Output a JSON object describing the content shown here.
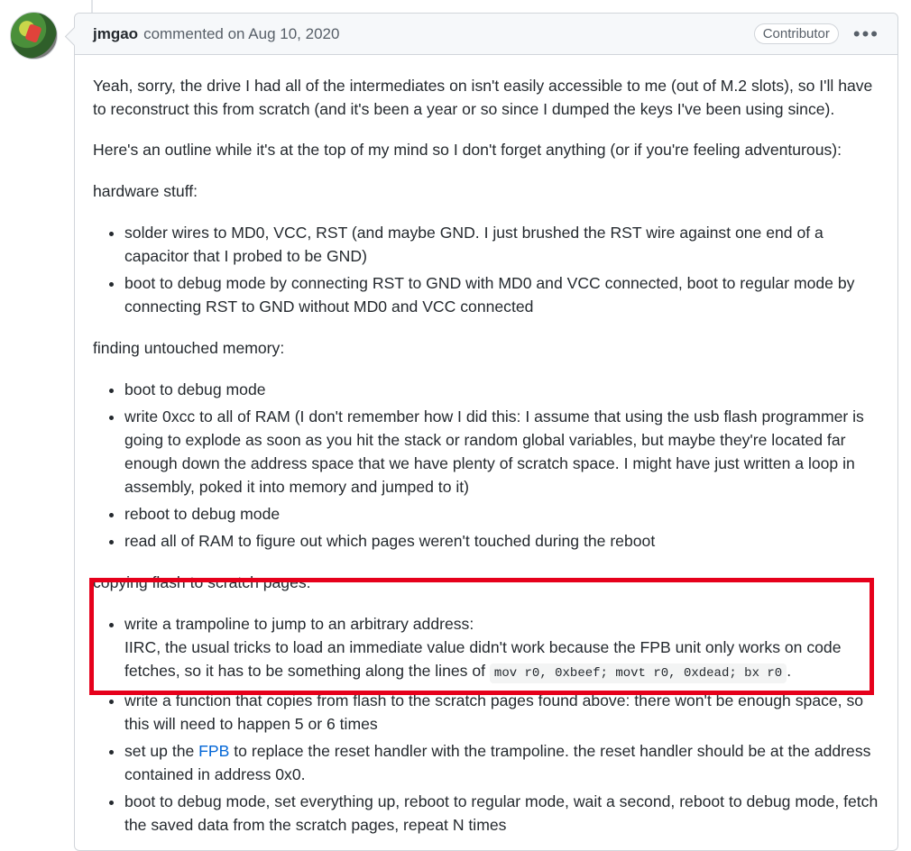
{
  "comment": {
    "author": "jmgao",
    "action": "commented on Aug 10, 2020",
    "badge": "Contributor",
    "menu_icon": "kebab-horizontal-icon",
    "avatar_icon": "user-avatar"
  },
  "body": {
    "p1": "Yeah, sorry, the drive I had all of the intermediates on isn't easily accessible to me (out of M.2 slots), so I'll have to reconstruct this from scratch (and it's been a year or so since I dumped the keys I've been using since).",
    "p2": "Here's an outline while it's at the top of my mind so I don't forget anything (or if you're feeling adventurous):",
    "h1": "hardware stuff:",
    "hw": [
      "solder wires to MD0, VCC, RST (and maybe GND. I just brushed the RST wire against one end of a capacitor that I probed to be GND)",
      "boot to debug mode by connecting RST to GND with MD0 and VCC connected, boot to regular mode by connecting RST to GND without MD0 and VCC connected"
    ],
    "h2": "finding untouched memory:",
    "mem": [
      "boot to debug mode",
      "write 0xcc to all of RAM (I don't remember how I did this: I assume that using the usb flash programmer is going to explode as soon as you hit the stack or random global variables, but maybe they're located far enough down the address space that we have plenty of scratch space. I might have just written a loop in assembly, poked it into memory and jumped to it)",
      "reboot to debug mode",
      "read all of RAM to figure out which pages weren't touched during the reboot"
    ],
    "h3": "copying flash to scratch pages:",
    "copy1_line1": "write a trampoline to jump to an arbitrary address:",
    "copy1_line2": "IIRC, the usual tricks to load an immediate value didn't work because the FPB unit only works on code fetches, so it has to be something along the lines of",
    "copy1_code": "mov r0, 0xbeef; movt r0, 0xdead; bx r0",
    "copy1_end": ".",
    "copy2": "write a function that copies from flash to the scratch pages found above: there won't be enough space, so this will need to happen 5 or 6 times",
    "copy3_pre": "set up the",
    "copy3_link": "FPB",
    "copy3_post": "to replace the reset handler with the trampoline. the reset handler should be at the address contained in address 0x0.",
    "copy4": "boot to debug mode, set everything up, reboot to regular mode, wait a second, reboot to debug mode, fetch the saved data from the scratch pages, repeat N times"
  },
  "colors": {
    "highlight": "#e6001b",
    "link": "#0366d6"
  }
}
